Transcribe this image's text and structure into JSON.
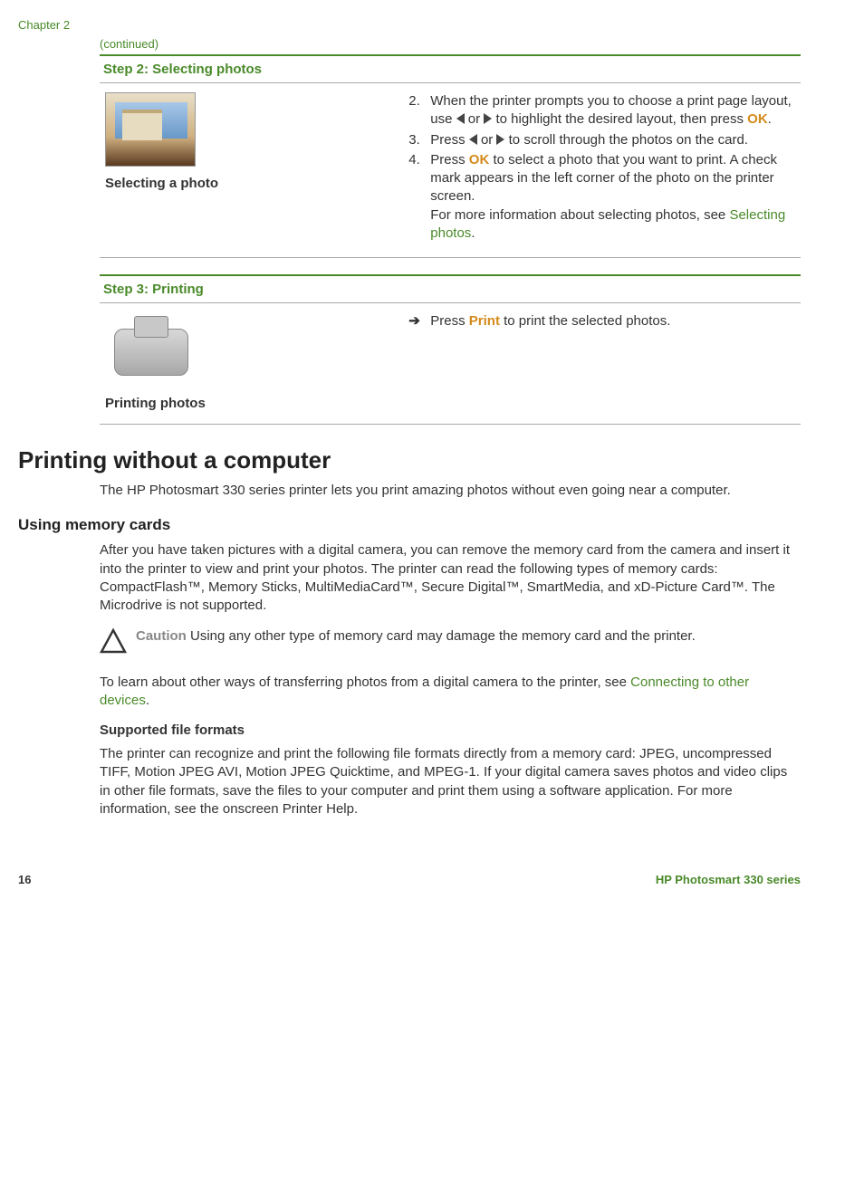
{
  "chapter_label": "Chapter 2",
  "continued": "(continued)",
  "step2": {
    "header": "Step 2: Selecting photos",
    "caption": "Selecting a photo",
    "items": [
      {
        "num": "2.",
        "pre": "When the printer prompts you to choose a print page layout, use ",
        "mid": " or ",
        "post": " to highlight the desired layout, then press ",
        "ok": "OK",
        "end": "."
      },
      {
        "num": "3.",
        "pre": "Press ",
        "mid": " or ",
        "post": " to scroll through the photos on the card."
      },
      {
        "num": "4.",
        "pre": "Press ",
        "ok": "OK",
        "mid2": " to select a photo that you want to print. A check mark appears in the left corner of the photo on the printer screen.",
        "more": "For more information about selecting photos, see ",
        "link": "Selecting photos",
        "end2": "."
      }
    ]
  },
  "step3": {
    "header": "Step 3: Printing",
    "caption": "Printing photos",
    "arrow": "➔",
    "text_pre": "Press ",
    "print_word": "Print",
    "text_post": " to print the selected photos."
  },
  "section_h1": "Printing without a computer",
  "intro": "The HP Photosmart 330 series printer lets you print amazing photos without even going near a computer.",
  "memcards_h2": "Using memory cards",
  "memcards_para": "After you have taken pictures with a digital camera, you can remove the memory card from the camera and insert it into the printer to view and print your photos. The printer can read the following types of memory cards: CompactFlash™, Memory Sticks, MultiMediaCard™, Secure Digital™, SmartMedia, and xD-Picture Card™. The Microdrive is not supported.",
  "caution_label": "Caution",
  "caution_text": "   Using any other type of memory card may damage the memory card and the printer.",
  "transfer_pre": "To learn about other ways of transferring photos from a digital camera to the printer, see ",
  "transfer_link": "Connecting to other devices",
  "transfer_post": ".",
  "supported_h3": "Supported file formats",
  "supported_para": "The printer can recognize and print the following file formats directly from a memory card: JPEG, uncompressed TIFF, Motion JPEG AVI, Motion JPEG Quicktime, and MPEG-1. If your digital camera saves photos and video clips in other file formats, save the files to your computer and print them using a software application. For more information, see the onscreen Printer Help.",
  "footer": {
    "page": "16",
    "product": "HP Photosmart 330 series"
  }
}
